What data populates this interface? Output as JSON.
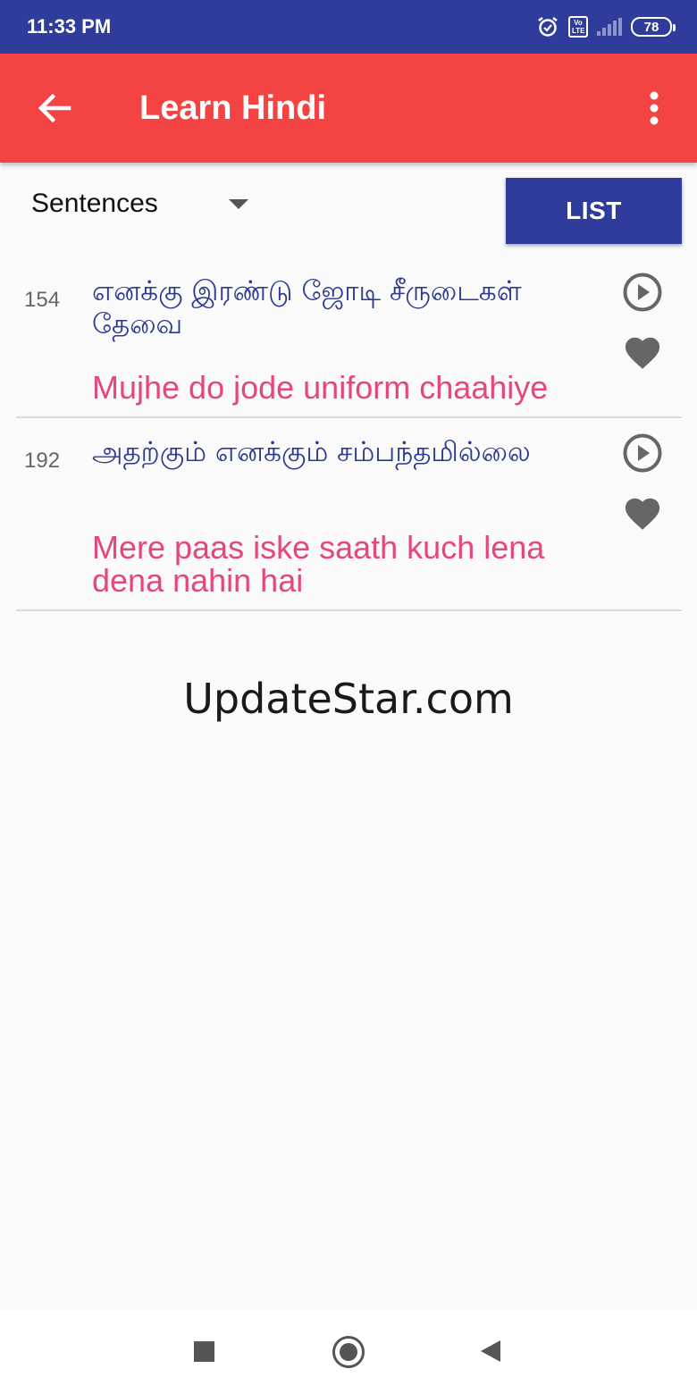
{
  "status_bar": {
    "time": "11:33 PM",
    "volte_line1": "Vo",
    "volte_line2": "LTE",
    "battery": "78",
    "icons": [
      "alarm-icon",
      "volte-icon",
      "signal-icon",
      "battery-icon"
    ]
  },
  "app_bar": {
    "title": "Learn Hindi",
    "back_icon": "arrow-left-icon",
    "menu_icon": "more-vert-icon",
    "color": "#f44343"
  },
  "controls": {
    "category": "Sentences",
    "list_button": "LIST",
    "accent": "#2f3c9c"
  },
  "items": [
    {
      "number": "154",
      "native": "எனக்கு இரண்டு ஜோடி சீருடைகள் தேவை",
      "transliteration": "Mujhe do jode uniform chaahiye"
    },
    {
      "number": "192",
      "native": "அதற்கும் எனக்கும் சம்பந்தமில்லை",
      "transliteration": "Mere paas iske saath kuch lena dena nahin hai"
    }
  ],
  "watermark": "UpdateStar.com",
  "colors": {
    "native_text": "#2b3990",
    "transliteration_text": "#e6457d",
    "icon_gray": "#666666"
  },
  "nav_bar": {
    "icons": [
      "recents-icon",
      "home-icon",
      "back-triangle-icon"
    ]
  }
}
